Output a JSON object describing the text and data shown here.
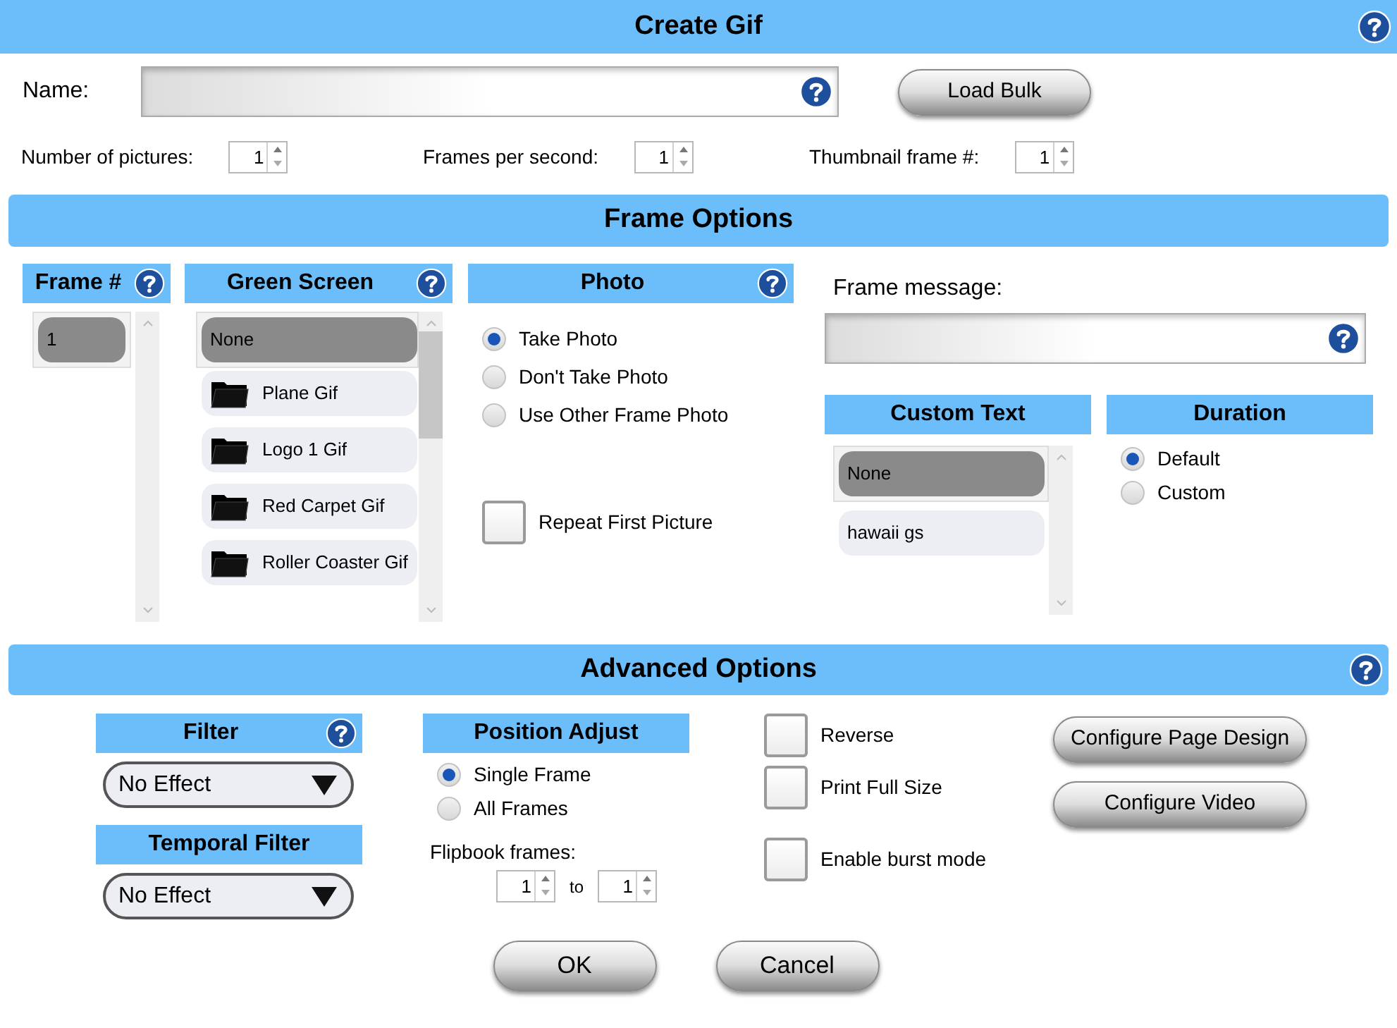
{
  "window": {
    "title": "Create Gif"
  },
  "name_field": {
    "label": "Name:"
  },
  "load_bulk_button": "Load Bulk",
  "spinners": [
    {
      "label": "Number of pictures:",
      "value": "1"
    },
    {
      "label": "Frames per second:",
      "value": "1"
    },
    {
      "label": "Thumbnail frame #:",
      "value": "1"
    }
  ],
  "frame_options": {
    "title": "Frame Options",
    "frame_list": {
      "title": "Frame #",
      "items": [
        {
          "label": "1",
          "selected": true
        }
      ]
    },
    "green_screen": {
      "title": "Green Screen",
      "items": [
        {
          "label": "None",
          "kind": "plain",
          "selected": true
        },
        {
          "label": "Plane Gif",
          "kind": "folder",
          "selected": false
        },
        {
          "label": "Logo 1 Gif",
          "kind": "folder",
          "selected": false
        },
        {
          "label": "Red Carpet Gif",
          "kind": "folder",
          "selected": false
        },
        {
          "label": "Roller Coaster Gif",
          "kind": "folder",
          "selected": false
        }
      ]
    },
    "photo": {
      "title": "Photo",
      "options": [
        {
          "label": "Take Photo",
          "selected": true
        },
        {
          "label": "Don't Take Photo",
          "selected": false
        },
        {
          "label": "Use Other Frame Photo",
          "selected": false
        }
      ],
      "repeat_first_picture": {
        "label": "Repeat First Picture",
        "checked": false
      }
    },
    "frame_message": {
      "label": "Frame message:"
    },
    "custom_text": {
      "title": "Custom Text",
      "items": [
        {
          "label": "None",
          "selected": true
        },
        {
          "label": "hawaii gs",
          "selected": false
        }
      ]
    },
    "duration": {
      "title": "Duration",
      "options": [
        {
          "label": "Default",
          "selected": true
        },
        {
          "label": "Custom",
          "selected": false
        }
      ]
    }
  },
  "advanced_options": {
    "title": "Advanced Options",
    "filter": {
      "title": "Filter",
      "value": "No Effect"
    },
    "temporal_filter": {
      "title": "Temporal Filter",
      "value": "No Effect"
    },
    "position_adjust": {
      "title": "Position Adjust",
      "options": [
        {
          "label": "Single Frame",
          "selected": true
        },
        {
          "label": "All Frames",
          "selected": false
        }
      ]
    },
    "flipbook": {
      "label": "Flipbook frames:",
      "from": "1",
      "separator": "to",
      "to": "1"
    },
    "checkboxes": [
      {
        "label": "Reverse",
        "checked": false
      },
      {
        "label": "Print Full Size",
        "checked": false
      },
      {
        "label": "Enable burst mode",
        "checked": false
      }
    ],
    "buttons": [
      "Configure Page Design",
      "Configure Video"
    ]
  },
  "buttons": [
    "OK",
    "Cancel"
  ]
}
